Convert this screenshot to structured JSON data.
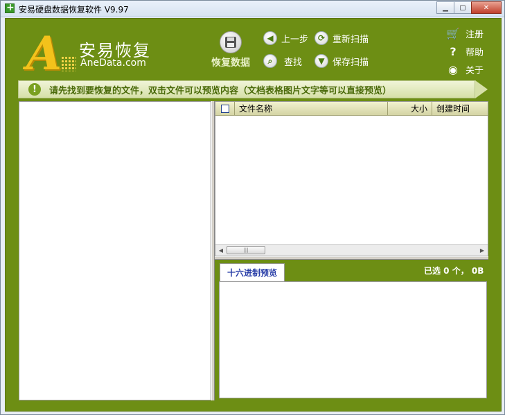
{
  "window": {
    "title": "安易硬盘数据恢复软件 V9.97",
    "controls": {
      "minimize": "▁",
      "maximize": "▢",
      "close": "✕"
    }
  },
  "brand": {
    "logo_letter": "A",
    "name_cn": "安易恢复",
    "name_en": "AneData.com"
  },
  "toolbar": {
    "recover_label": "恢复数据",
    "back_label": "上一步",
    "rescan_label": "重新扫描",
    "find_label": "查找",
    "save_scan_label": "保存扫描"
  },
  "menu": {
    "register_label": "注册",
    "help_label": "帮助",
    "about_label": "关于"
  },
  "notice": {
    "text": "请先找到要恢复的文件，双击文件可以预览内容（文档表格图片文字等可以直接预览）"
  },
  "file_list": {
    "columns": {
      "name": "文件名称",
      "size": "大小",
      "created": "创建时间"
    },
    "rows": []
  },
  "preview": {
    "tab_label": "十六进制预览",
    "selected_info": "已选 0 个， 0B"
  },
  "colors": {
    "main_green": "#6d8e14",
    "logo_yellow": "#f3c21b",
    "notice_bg": "#e6ecc4",
    "tab_text": "#2a3fa8"
  }
}
